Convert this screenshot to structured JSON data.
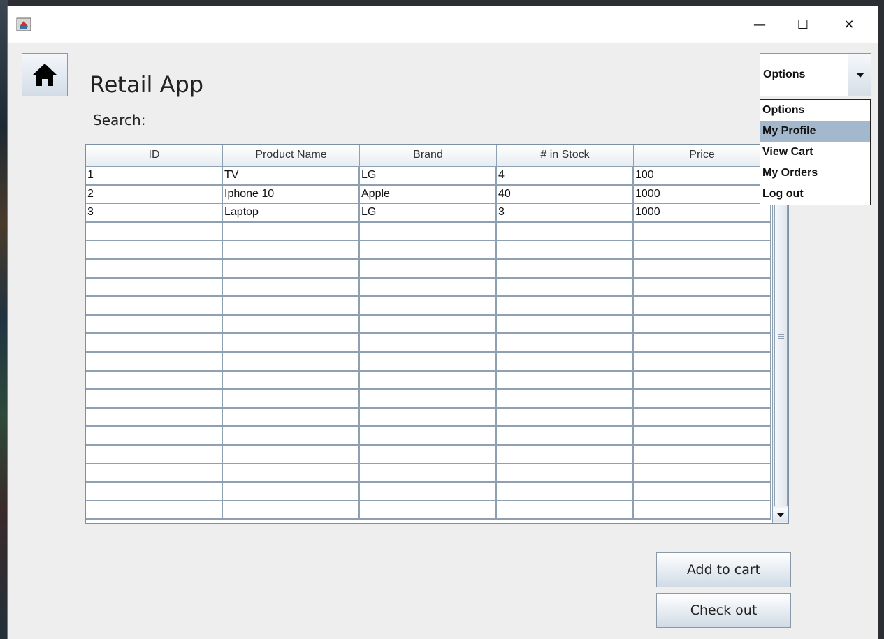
{
  "window": {
    "minimize_glyph": "—",
    "maximize_glyph": "☐",
    "close_glyph": "✕"
  },
  "header": {
    "title": "Retail App",
    "search_label": "Search:",
    "home_icon": "home-icon"
  },
  "options_combo": {
    "selected": "Options",
    "items": [
      "Options",
      "My Profile",
      "View Cart",
      "My Orders",
      "Log out"
    ],
    "highlighted": "My Profile"
  },
  "table": {
    "columns": [
      "ID",
      "Product Name",
      "Brand",
      "# in Stock",
      "Price"
    ],
    "rows": [
      [
        "1",
        "TV",
        "LG",
        "4",
        "100"
      ],
      [
        "2",
        "Iphone 10",
        "Apple",
        "40",
        "1000"
      ],
      [
        "3",
        "Laptop",
        "LG",
        "3",
        "1000"
      ]
    ]
  },
  "actions": {
    "add_to_cart": "Add to cart",
    "check_out": "Check out"
  },
  "colors": {
    "selection": "#a3b8cc",
    "grid": "#8fa0b3",
    "background": "#eeeeee"
  }
}
